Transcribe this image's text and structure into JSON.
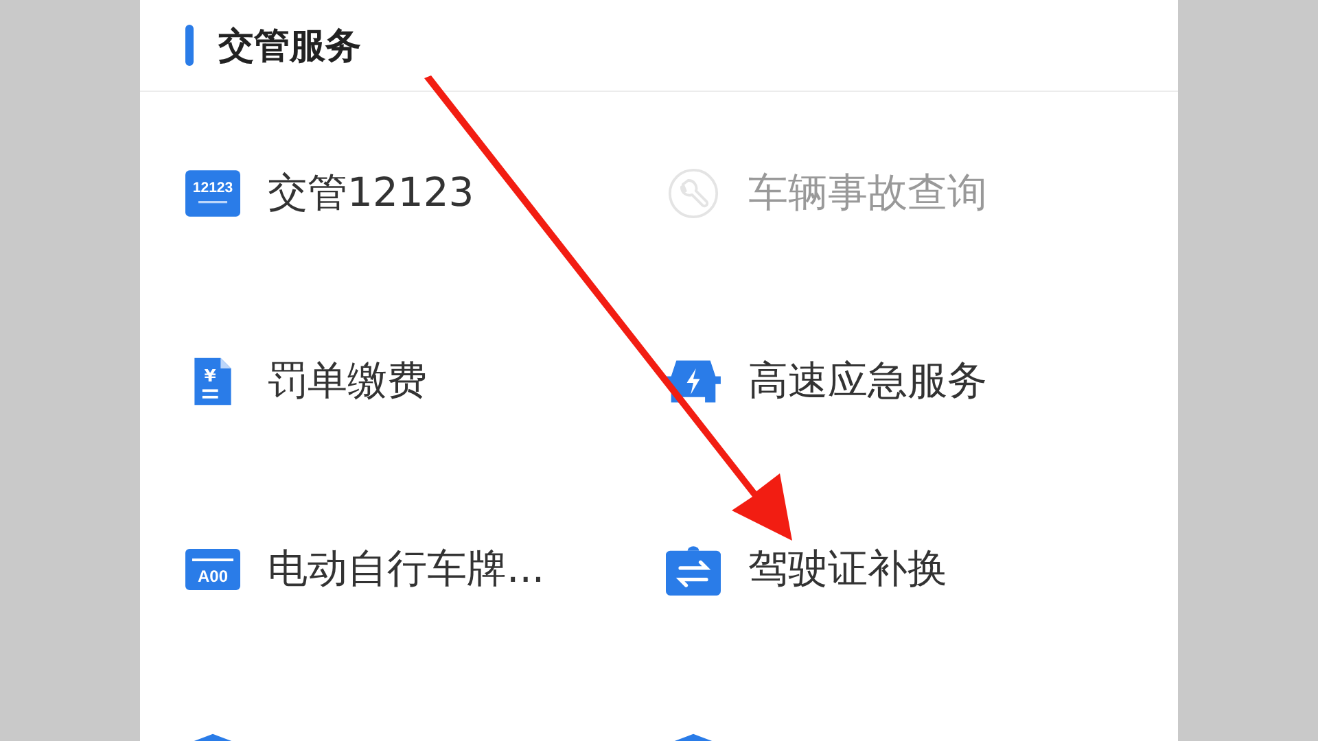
{
  "section": {
    "title": "交管服务"
  },
  "items": [
    {
      "kind": "app12123",
      "label": "交管12123",
      "icon_text": "12123",
      "disabled": false
    },
    {
      "kind": "wrench",
      "label": "车辆事故查询",
      "disabled": true
    },
    {
      "kind": "bill",
      "label": "罚单缴费",
      "icon_text": "¥",
      "disabled": false
    },
    {
      "kind": "emergency",
      "label": "高速应急服务",
      "disabled": false
    },
    {
      "kind": "plate",
      "label": "电动自行车牌...",
      "icon_text": "A00",
      "disabled": false
    },
    {
      "kind": "swap",
      "label": "驾驶证补换",
      "disabled": false
    },
    {
      "kind": "shield"
    },
    {
      "kind": "shield"
    }
  ],
  "annotation": {
    "kind": "arrow"
  }
}
